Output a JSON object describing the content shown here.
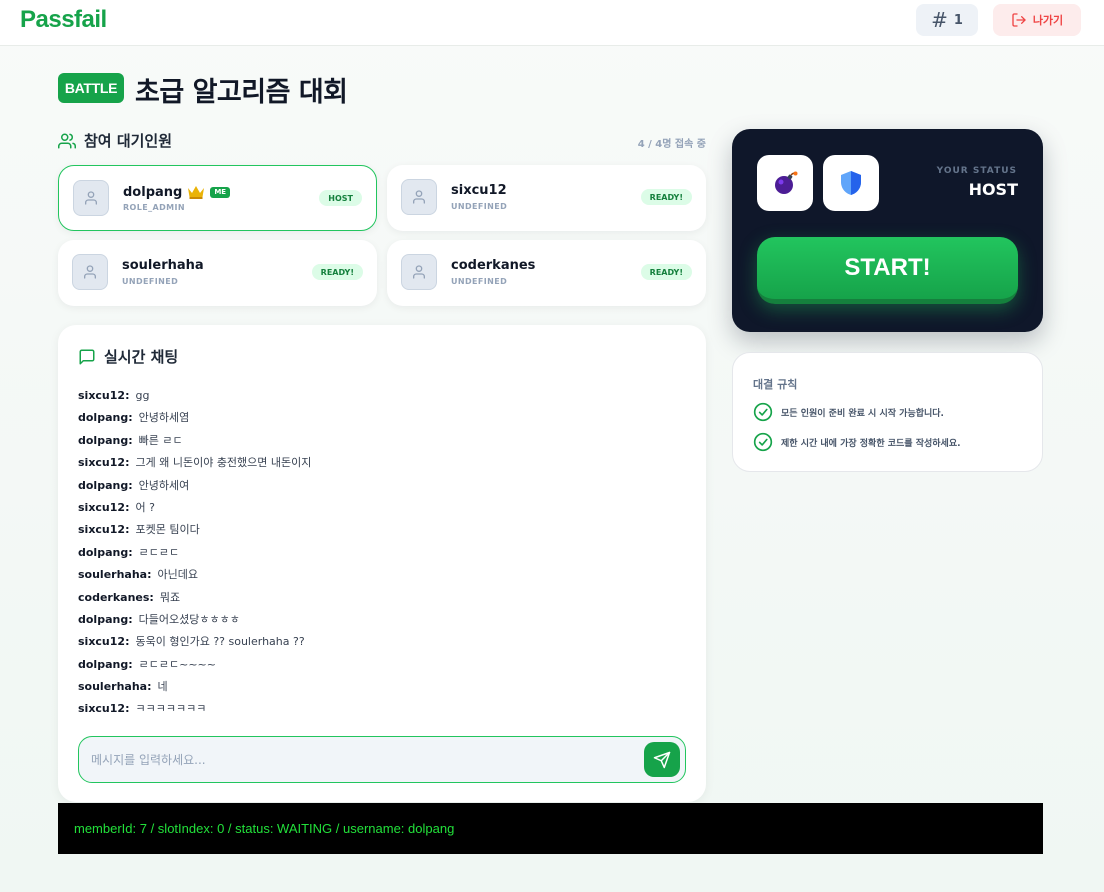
{
  "header": {
    "logo": "Passfail",
    "room_number": "1",
    "leave_label": "나가기"
  },
  "title": {
    "badge": "BATTLE",
    "text": "초급 알고리즘 대회"
  },
  "participants": {
    "heading": "참여 대기인원",
    "online": "4 / 4명 접속 중",
    "players": [
      {
        "name": "dolpang",
        "role": "ROLE_ADMIN",
        "status": "HOST",
        "me_label": "ME",
        "is_me": true
      },
      {
        "name": "sixcu12",
        "role": "UNDEFINED",
        "status": "READY!"
      },
      {
        "name": "soulerhaha",
        "role": "UNDEFINED",
        "status": "READY!"
      },
      {
        "name": "coderkanes",
        "role": "UNDEFINED",
        "status": "READY!"
      }
    ]
  },
  "chat": {
    "heading": "실시간 채팅",
    "messages": [
      {
        "user": "sixcu12",
        "text": "gg"
      },
      {
        "user": "dolpang",
        "text": "안녕하세염"
      },
      {
        "user": "dolpang",
        "text": "빠른 ㄹㄷ"
      },
      {
        "user": "sixcu12",
        "text": "그게 왜 니돈이야 충전했으면 내돈이지"
      },
      {
        "user": "dolpang",
        "text": "안녕하세여"
      },
      {
        "user": "sixcu12",
        "text": "어 ?"
      },
      {
        "user": "sixcu12",
        "text": "포켓몬 팀이다"
      },
      {
        "user": "dolpang",
        "text": "ㄹㄷㄹㄷ"
      },
      {
        "user": "soulerhaha",
        "text": "아닌데요"
      },
      {
        "user": "coderkanes",
        "text": "뭐죠"
      },
      {
        "user": "dolpang",
        "text": "다들어오셨당ㅎㅎㅎㅎ"
      },
      {
        "user": "sixcu12",
        "text": "동욱이 형인가요 ?? soulerhaha ??"
      },
      {
        "user": "dolpang",
        "text": "ㄹㄷㄹㄷ~~~~"
      },
      {
        "user": "soulerhaha",
        "text": "네"
      },
      {
        "user": "sixcu12",
        "text": "ㅋㅋㅋㅋㅋㅋㅋ"
      }
    ],
    "separator": ":",
    "input_placeholder": "메시지를 입력하세요...",
    "input_value": ""
  },
  "status_card": {
    "label": "YOUR STATUS",
    "value": "HOST",
    "start_label": "START!"
  },
  "rules": {
    "heading": "대결 규칙",
    "items": [
      "모든 인원이 준비 완료 시 시작 가능합니다.",
      "제한 시간 내에 가장 정확한 코드를 작성하세요."
    ]
  },
  "debug": {
    "text": "memberId: 7 / slotIndex: 0 / status: WAITING / username: dolpang"
  },
  "colors": {
    "brand": "#16a34a",
    "danger": "#ef4444",
    "dark_panel": "#0f172a",
    "debug_text": "#22e03a"
  }
}
